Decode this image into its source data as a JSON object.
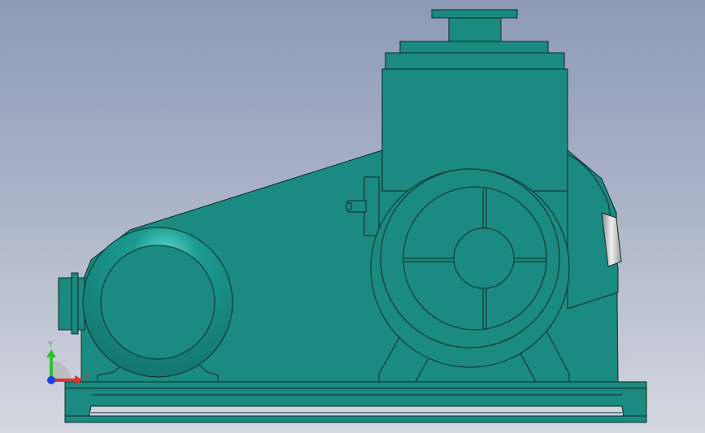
{
  "viewport": {
    "background_top": "#8e9ab6",
    "background_bottom": "#d4d8e0"
  },
  "model": {
    "body_color": "#1b8a80",
    "edge_color": "#0b2b28",
    "highlight_color": "#4fd0c6",
    "window_color": "#c8c8c8"
  },
  "triad": {
    "x_label": "X",
    "y_label": "Y",
    "x_color": "#e03030",
    "y_color": "#30c030",
    "z_color": "#2040e0"
  }
}
